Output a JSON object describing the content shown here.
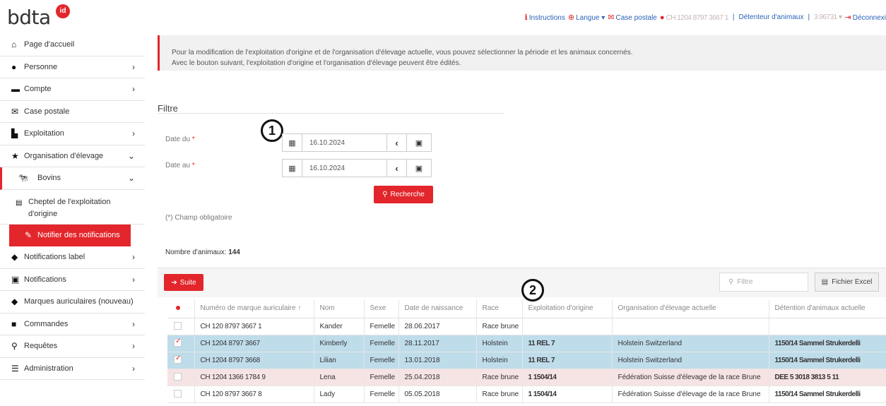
{
  "logo": {
    "text": "bdta",
    "badge": "id"
  },
  "topnav": {
    "instructions": "Instructions",
    "langue": "Langue ▾",
    "case_postale": "Case postale",
    "user": "CH 1204 8797 3667 1",
    "role": "Détenteur d'animaux",
    "account": "3.96731 ▾",
    "logout": "Déconnexi"
  },
  "sidebar": {
    "items": [
      {
        "label": "Page d'accueil",
        "icon": "home-icon"
      },
      {
        "label": "Personne",
        "icon": "user-icon"
      },
      {
        "label": "Compte",
        "icon": "id-card-icon"
      },
      {
        "label": "Case postale",
        "icon": "envelope-icon"
      },
      {
        "label": "Exploitation",
        "icon": "industry-icon"
      },
      {
        "label": "Organisation d'élevage",
        "icon": "star-icon"
      },
      {
        "label": "Bovins",
        "icon": "cow-icon"
      },
      {
        "label": "Cheptel de l'exploitation d'origine",
        "icon": "list-icon"
      },
      {
        "label": "Notifier des notifications",
        "icon": "pencil-icon"
      },
      {
        "label": "Notifications label",
        "icon": "tags-icon"
      },
      {
        "label": "Notifications",
        "icon": "clipboard-icon"
      },
      {
        "label": "Marques auriculaires (nouveau)",
        "icon": "tag-icon"
      },
      {
        "label": "Commandes",
        "icon": "shopping-bag-icon"
      },
      {
        "label": "Requêtes",
        "icon": "search-icon"
      },
      {
        "label": "Administration",
        "icon": "sliders-icon"
      }
    ]
  },
  "banner": {
    "line1": "Pour la modification de l'exploitation d'origine et de l'organisation d'élevage actuelle, vous pouvez sélectionner la période et les animaux concernés.",
    "line2": "Avec le bouton suivant, l'exploitation d'origine et l'organisation d'élevage peuvent être édités."
  },
  "filter": {
    "title": "Filtre",
    "date_from_label": "Date du",
    "date_to_label": "Date au",
    "required_mark": "*",
    "date_from": "16.10.2024",
    "date_to": "16.10.2024",
    "search_button": "Recherche",
    "required_note": "(*) Champ obligatoire",
    "callout1": "1"
  },
  "results": {
    "count_label": "Nombre d'animaux:",
    "count": "144",
    "suite_button": "Suite",
    "filter_placeholder": "Filtre",
    "excel_button": "Fichier Excel",
    "callout2": "2"
  },
  "table": {
    "headers": [
      "",
      "Numéro de marque auriculaire ↑",
      "Nom",
      "Sexe",
      "Date de naissance",
      "Race",
      "Exploitation d'origine",
      "Organisation d'élevage actuelle",
      "Détention d'animaux actuelle"
    ],
    "rows": [
      {
        "state": "normal",
        "checked": false,
        "ear": "CH 120 8797 3667 1",
        "name": "Kander",
        "sex": "Femelle",
        "birth": "28.06.2017",
        "race": "Race brune",
        "origin": "",
        "org": "",
        "det": ""
      },
      {
        "state": "selected",
        "checked": true,
        "ear": "CH 1204 8797 3667",
        "name": "Kimberly",
        "sex": "Femelle",
        "birth": "28.11.2017",
        "race": "Holstein",
        "origin": "11 REL 7",
        "org": "Holstein Switzerland",
        "det": "1150/14 Sammel Strukerdelli"
      },
      {
        "state": "selected",
        "checked": true,
        "ear": "CH 1204 8797 3668",
        "name": "Lilian",
        "sex": "Femelle",
        "birth": "13.01.2018",
        "race": "Holstein",
        "origin": "11 REL 7",
        "org": "Holstein Switzerland",
        "det": "1150/14 Sammel Strukerdelli"
      },
      {
        "state": "pink",
        "checked": false,
        "ear": "CH 1204 1366 1784 9",
        "name": "Lena",
        "sex": "Femelle",
        "birth": "25.04.2018",
        "race": "Race brune",
        "origin": "1 1504/14",
        "org": "Fédération Suisse d'élevage de la race Brune",
        "det": "DEE 5 3018 3813 5 11"
      },
      {
        "state": "normal",
        "checked": false,
        "ear": "CH 120 8797 3667 8",
        "name": "Lady",
        "sex": "Femelle",
        "birth": "05.05.2018",
        "race": "Race brune",
        "origin": "1 1504/14",
        "org": "Fédération Suisse d'élevage de la race Brune",
        "det": "1150/14 Sammel Strukerdelli"
      }
    ]
  }
}
